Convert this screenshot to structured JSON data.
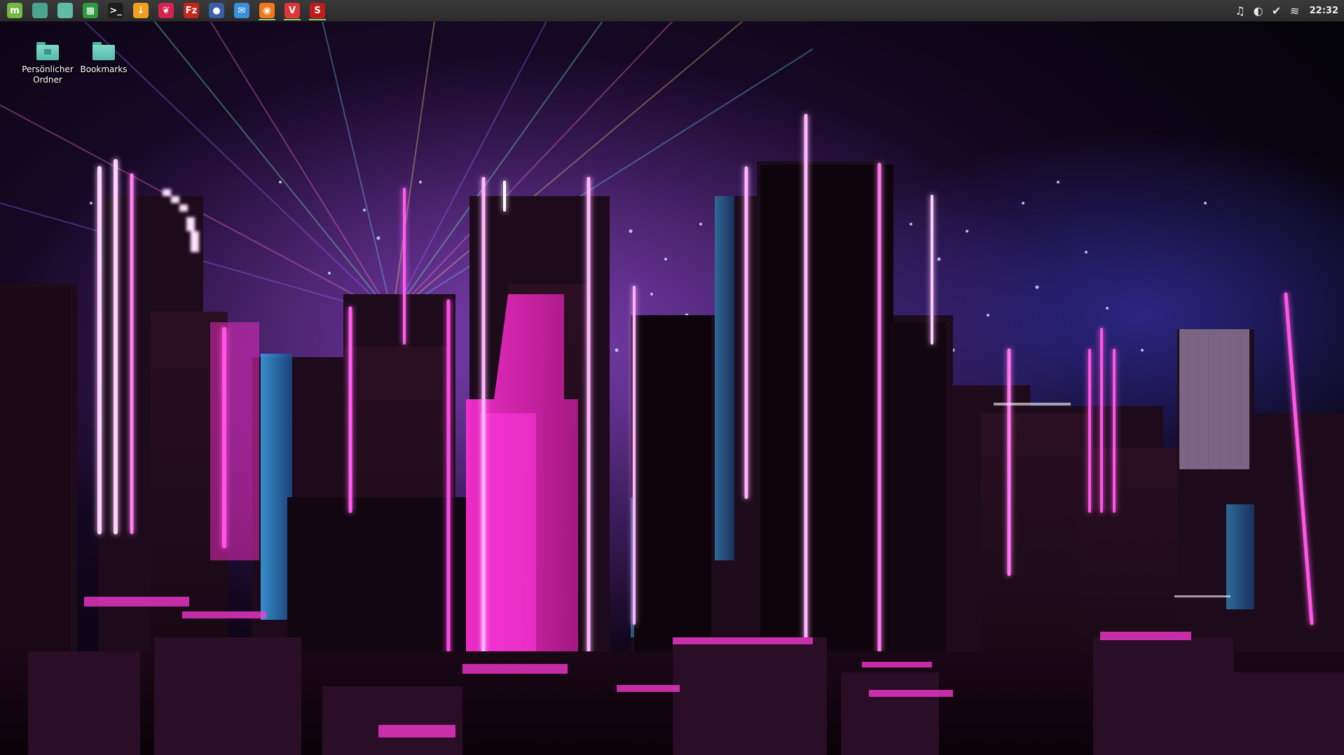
{
  "panel": {
    "launchers": [
      {
        "name": "menu-icon",
        "glyph": "m",
        "color": "#76b642",
        "running": false
      },
      {
        "name": "files-icon",
        "glyph": "",
        "color": "#4aa58c",
        "running": false
      },
      {
        "name": "folder-icon",
        "glyph": "",
        "color": "#5fbca9",
        "running": false
      },
      {
        "name": "libreoffice-calc-icon",
        "glyph": "▦",
        "color": "#2c9b3f",
        "running": false
      },
      {
        "name": "terminal-icon",
        "glyph": ">_",
        "color": "#1d1d1d",
        "running": false
      },
      {
        "name": "update-manager-icon",
        "glyph": "↓",
        "color": "#f0a020",
        "running": false
      },
      {
        "name": "raspberry-icon",
        "glyph": "❦",
        "color": "#d4234f",
        "running": false
      },
      {
        "name": "filezilla-icon",
        "glyph": "Fz",
        "color": "#c4261b",
        "running": false
      },
      {
        "name": "droplet-icon",
        "glyph": "●",
        "color": "#3a5ea8",
        "running": false
      },
      {
        "name": "mail-icon",
        "glyph": "✉",
        "color": "#3a8fd8",
        "running": false
      },
      {
        "name": "firefox-icon",
        "glyph": "◉",
        "color": "#f07a1a",
        "running": true
      },
      {
        "name": "vivaldi-icon",
        "glyph": "V",
        "color": "#e0363a",
        "running": true
      },
      {
        "name": "mintupdate-icon",
        "glyph": "S",
        "color": "#c21b1b",
        "running": true
      }
    ],
    "tray": [
      {
        "name": "music-icon",
        "glyph": "♫"
      },
      {
        "name": "steam-icon",
        "glyph": "◐"
      },
      {
        "name": "shield-icon",
        "glyph": "✔"
      },
      {
        "name": "wifi-icon",
        "glyph": "≋"
      }
    ],
    "clock": "22:32"
  },
  "desktop_icons": [
    {
      "name": "home-folder",
      "label": "Persönlicher\nOrdner",
      "home": true
    },
    {
      "name": "bookmarks-folder",
      "label": "Bookmarks",
      "home": false
    }
  ]
}
